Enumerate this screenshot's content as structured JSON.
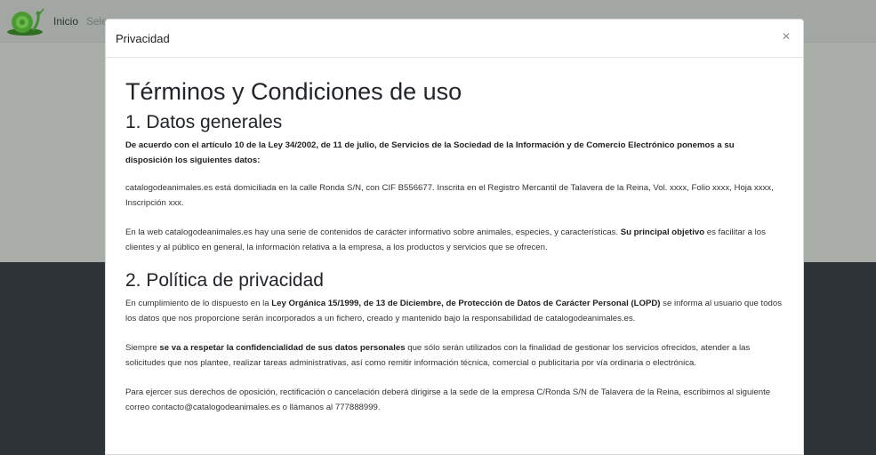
{
  "navbar": {
    "home_label": "Inicio",
    "next_label": "Sele"
  },
  "modal": {
    "title": "Privacidad",
    "close_label": "×",
    "heading": "Términos y Condiciones de uso",
    "section1": {
      "title": "1. Datos generales",
      "intro": "De acuerdo con el artículo 10 de la Ley 34/2002, de 11 de julio, de Servicios de la Sociedad de la Información y de Comercio Electrónico ponemos a su disposición los siguientes datos:",
      "p1": "catalogodeanimales.es está domiciliada en la calle Ronda S/N, con CIF B556677. Inscrita en el Registro Mercantil de Talavera de la Reina, Vol. xxxx, Folio xxxx, Hoja xxxx, Inscripción xxx.",
      "p2_a": "En la web catalogodeanimales.es hay una serie de contenidos de carácter informativo sobre animales, especies, y características. ",
      "p2_b": "Su principal objetivo",
      "p2_c": " es facilitar a los clientes y al público en general, la información relativa a la empresa, a los productos y servicios que se ofrecen."
    },
    "section2": {
      "title": "2. Política de privacidad",
      "p1_a": "En cumplimiento de lo dispuesto en la ",
      "p1_b": "Ley Orgánica 15/1999, de 13 de Diciembre, de Protección de Datos de Carácter Personal (LOPD)",
      "p1_c": " se informa al usuario que todos los datos que nos proporcione serán incorporados a un fichero, creado y mantenido bajo la responsabilidad de catalogodeanimales.es.",
      "p2_a": "Siempre ",
      "p2_b": "se va a respetar la confidencialidad de sus datos personales",
      "p2_c": " que sólo serán utilizados con la finalidad de gestionar los servicios ofrecidos, atender a las solicitudes que nos plantee, realizar tareas administrativas, así como remitir información técnica, comercial o publicitaria por vía ordinaria o electrónica.",
      "p3": "Para ejercer sus derechos de oposición, rectificación o cancelación deberá dirigirse a la sede de la empresa C/Ronda S/N de Talavera de la Reina, escribirnos al siguiente correo contacto@catalogodeanimales.es o llámanos al 777888999."
    }
  },
  "colors": {
    "backdrop_top": "#a9aea9",
    "backdrop_bottom": "#2e3337",
    "logo_green": "#3f8f2e"
  },
  "icons": {
    "logo": "snail-logo-icon",
    "close": "close-icon"
  }
}
